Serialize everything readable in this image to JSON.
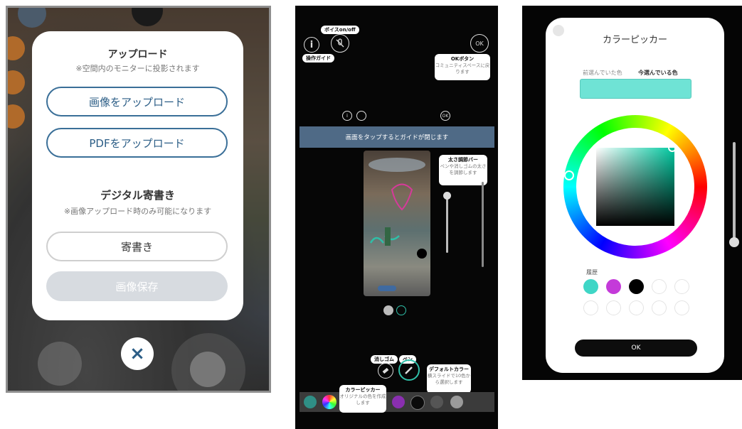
{
  "upload_dialog": {
    "title": "アップロード",
    "note": "※空間内のモニターに投影されます",
    "upload_image_label": "画像をアップロード",
    "upload_pdf_label": "PDFをアップロード",
    "digital_title": "デジタル寄書き",
    "digital_note": "※画像アップロード時のみ可能になります",
    "yosegaki_label": "寄書き",
    "save_image_label": "画像保存",
    "close_glyph": "×"
  },
  "guide": {
    "voice_tag": "ボイスon/off",
    "guide_tag": "操作ガイド",
    "info_glyph": "i",
    "ok_circle_label": "OK",
    "ok_small_label": "OK",
    "ok_box": {
      "title": "OKボタン",
      "desc": "コミュニティスペースに戻ります"
    },
    "banner": "画面をタップするとガイドが閉じます",
    "thickness_box": {
      "title": "太さ調節バー",
      "desc": "ペンや消しゴムの太さを調節します"
    },
    "eraser_tag": "消しゴム",
    "pen_tag": "ペン",
    "default_color_box": {
      "title": "デフォルトカラー",
      "desc": "横スライドで10色から選択します"
    },
    "color_picker_box": {
      "title": "カラーピッカー",
      "desc": "オリジナルの色を作成します"
    },
    "palette_colors": [
      "#2f8f86",
      "#8a2fb0",
      "#0b0b0b",
      "#555555",
      "#9a9a9a"
    ]
  },
  "color_picker": {
    "title": "カラーピッカー",
    "prev_label": "前選んでいた色",
    "current_label": "今選んでいる色",
    "current_color": "#6fe3d5",
    "history_label": "履歴",
    "history_colors": [
      "#3fd6c6",
      "#c43ad9",
      "#000000"
    ],
    "ok_label": "OK"
  }
}
